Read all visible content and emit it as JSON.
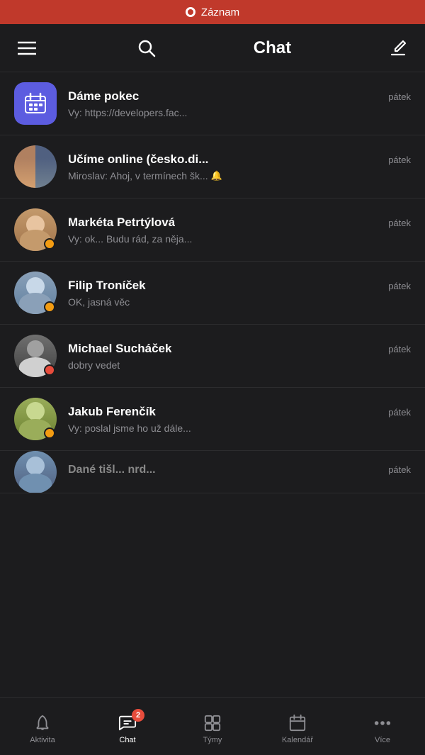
{
  "statusBar": {
    "recordLabel": "Záznam"
  },
  "header": {
    "title": "Chat",
    "hamburgerLabel": "Menu",
    "searchLabel": "Search",
    "composeLabel": "Compose"
  },
  "chats": [
    {
      "id": "dame-pokec",
      "name": "Dáme pokec",
      "time": "pátek",
      "preview": "Vy: https://developers.fac...",
      "avatarType": "calendar",
      "muted": false,
      "badge": "",
      "avatarColor": "#5c5ce0"
    },
    {
      "id": "ucime-online",
      "name": "Učíme online (česko.di...",
      "time": "pátek",
      "preview": "Miroslav: Ahoj, v termínech šk...",
      "avatarType": "multi",
      "muted": true,
      "badge": "",
      "avatarColor": ""
    },
    {
      "id": "marketa",
      "name": "Markéta Petrtýlová",
      "time": "pátek",
      "preview": "Vy: ok... Budu rád, za něja...",
      "avatarType": "person",
      "muted": false,
      "badge": "orange",
      "avatarColor": "#a0522d"
    },
    {
      "id": "filip",
      "name": "Filip Troníček",
      "time": "pátek",
      "preview": "OK, jasná věc",
      "avatarType": "person",
      "muted": false,
      "badge": "orange",
      "avatarColor": "#5d7b9a"
    },
    {
      "id": "michael",
      "name": "Michael Sucháček",
      "time": "pátek",
      "preview": "dobry vedet",
      "avatarType": "person",
      "muted": false,
      "badge": "red",
      "avatarColor": "#3a3a3c"
    },
    {
      "id": "jakub",
      "name": "Jakub Ferenčík",
      "time": "pátek",
      "preview": "Vy: poslal jsme ho už dále...",
      "avatarType": "person",
      "muted": false,
      "badge": "orange",
      "avatarColor": "#6b6b3a"
    },
    {
      "id": "partial",
      "name": "Dané tišl... nrd...",
      "time": "pátek",
      "preview": "",
      "avatarType": "person",
      "muted": false,
      "badge": "",
      "avatarColor": "#4a5568"
    }
  ],
  "bottomNav": [
    {
      "id": "aktivita",
      "label": "Aktivita",
      "icon": "bell",
      "active": false,
      "badge": ""
    },
    {
      "id": "chat",
      "label": "Chat",
      "icon": "chat",
      "active": true,
      "badge": "2"
    },
    {
      "id": "tymy",
      "label": "Týmy",
      "icon": "teams",
      "active": false,
      "badge": ""
    },
    {
      "id": "kalendar",
      "label": "Kalendář",
      "icon": "calendar",
      "active": false,
      "badge": ""
    },
    {
      "id": "vice",
      "label": "Více",
      "icon": "more",
      "active": false,
      "badge": ""
    }
  ]
}
